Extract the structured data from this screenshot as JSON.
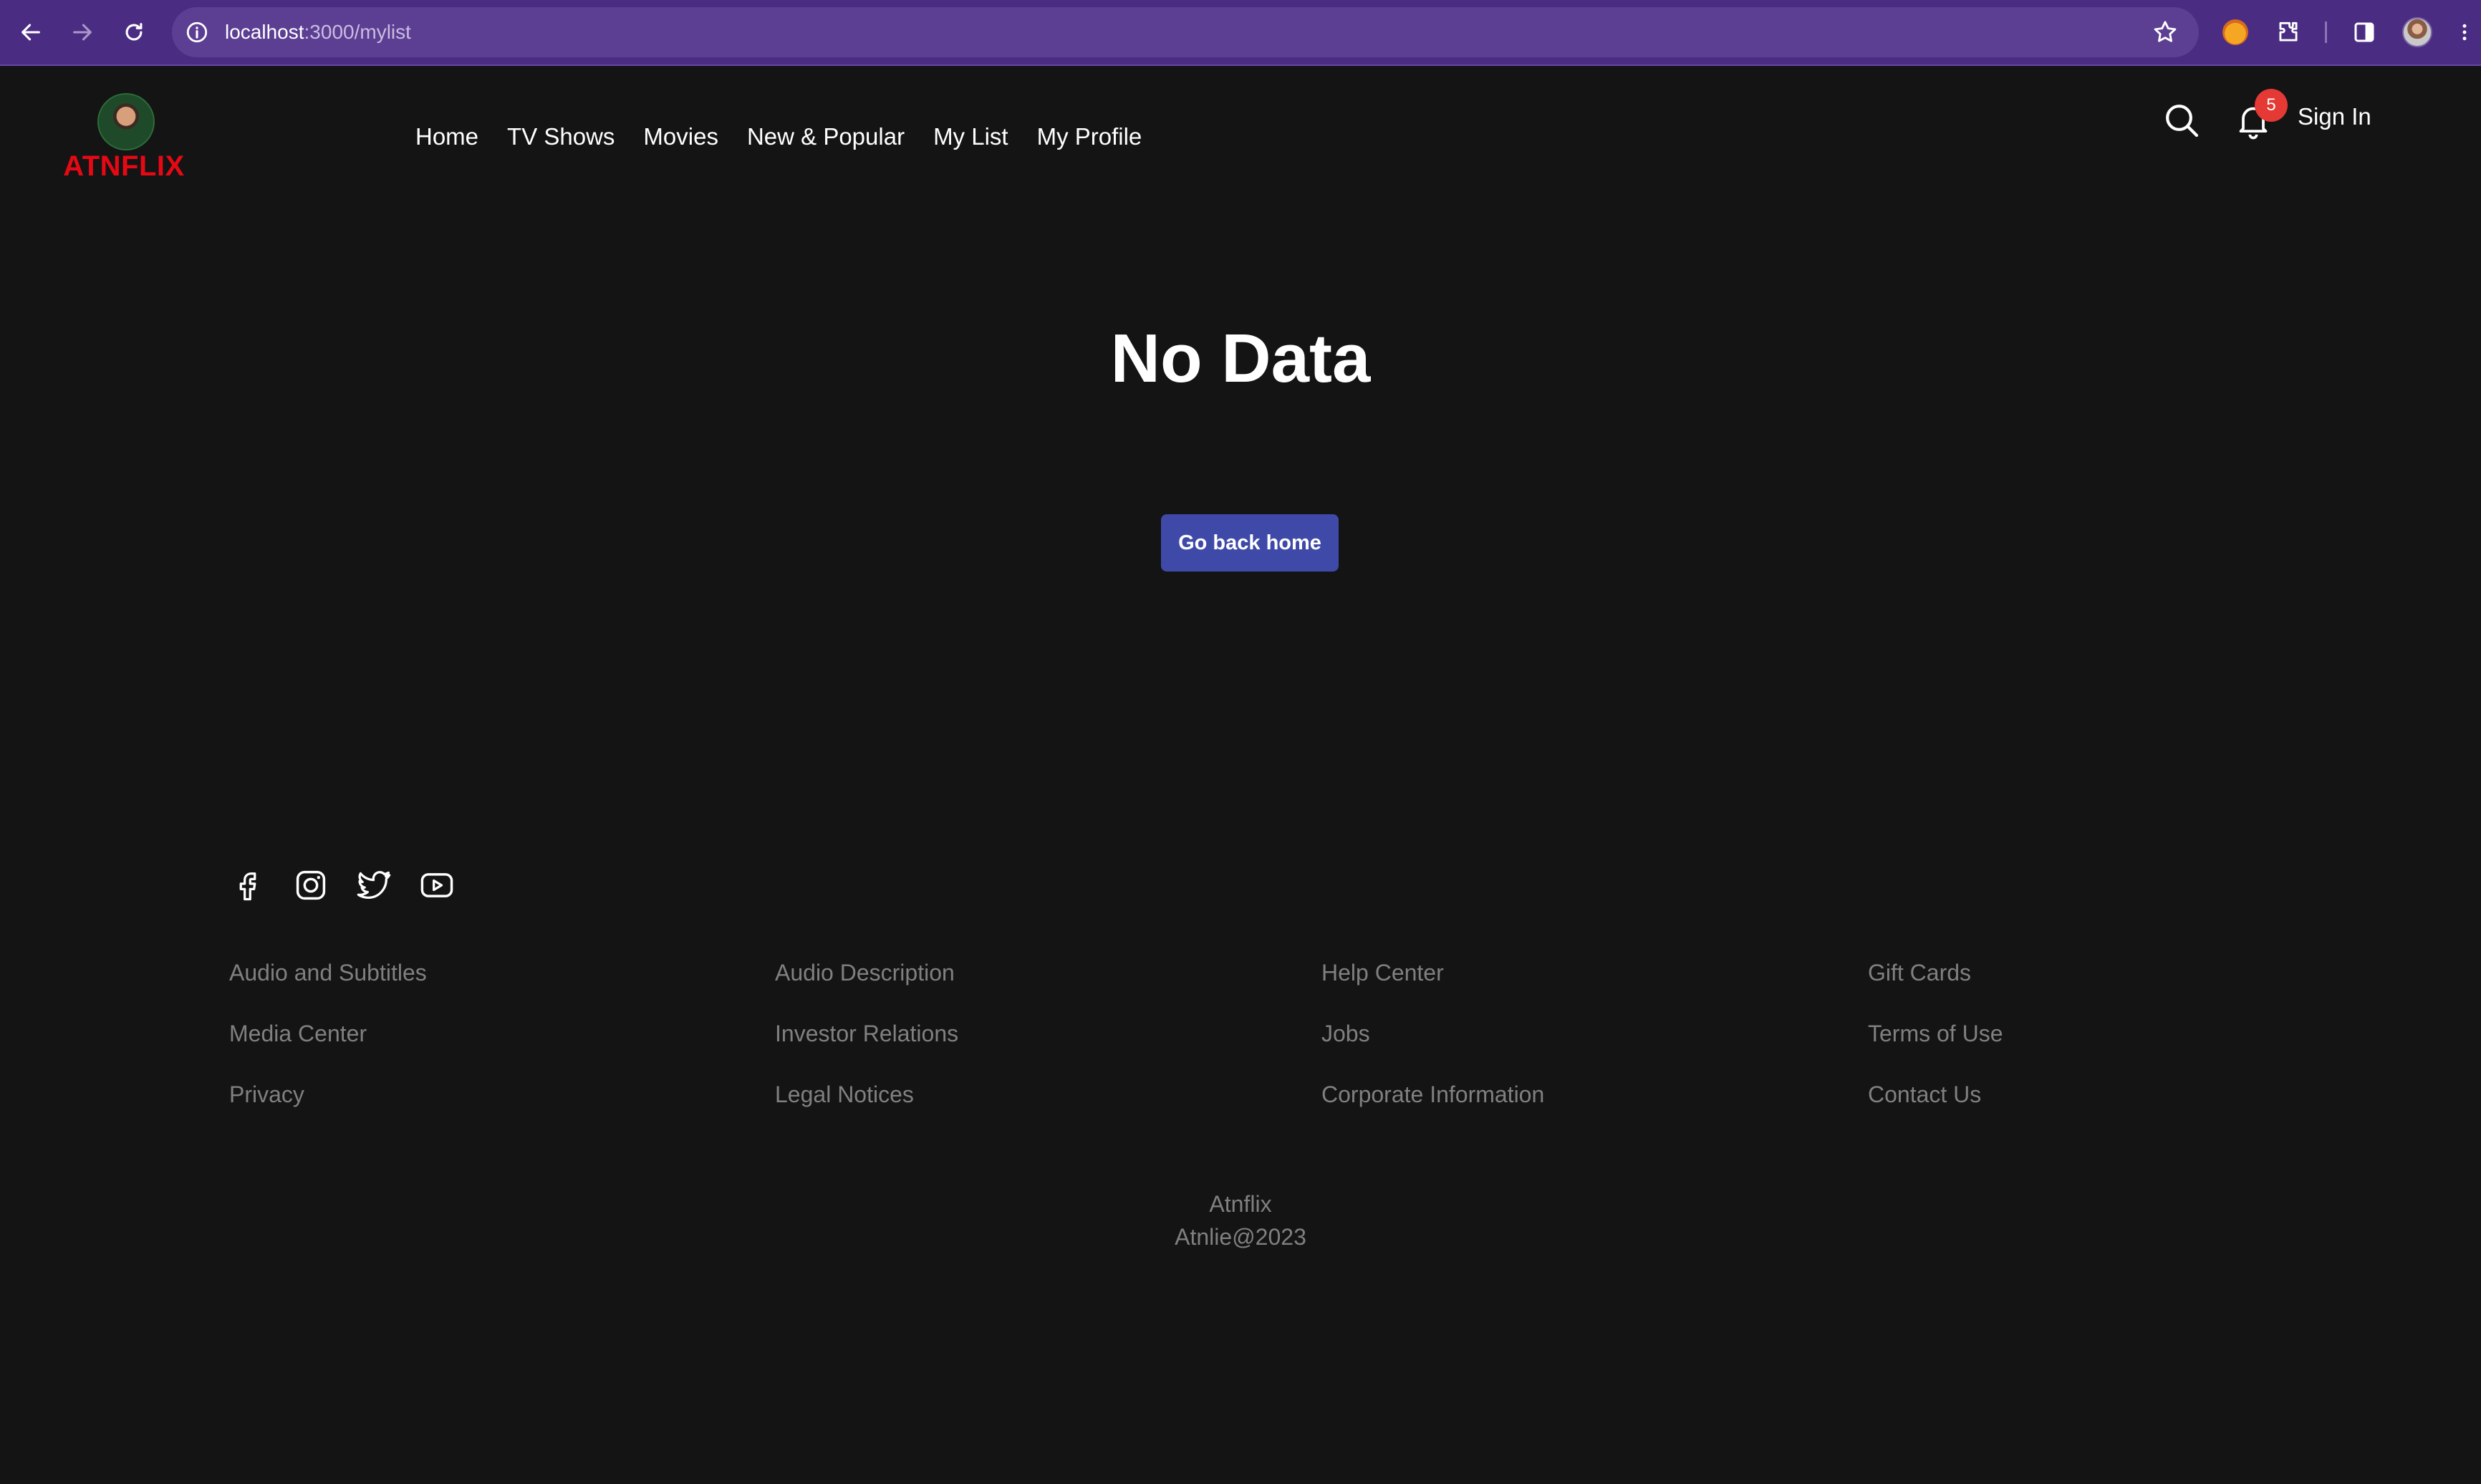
{
  "browser": {
    "url_host": "localhost",
    "url_path": ":3000/mylist"
  },
  "header": {
    "logo_text": "ATNFLIX",
    "nav": [
      {
        "label": "Home"
      },
      {
        "label": "TV Shows"
      },
      {
        "label": "Movies"
      },
      {
        "label": "New & Popular"
      },
      {
        "label": "My List"
      },
      {
        "label": "My Profile"
      }
    ],
    "notification_count": "5",
    "sign_in_label": "Sign In"
  },
  "main": {
    "title": "No Data",
    "button_label": "Go back home"
  },
  "footer": {
    "social": [
      "facebook-icon",
      "instagram-icon",
      "twitter-icon",
      "youtube-icon"
    ],
    "columns": [
      [
        "Audio and Subtitles",
        "Media Center",
        "Privacy"
      ],
      [
        "Audio Description",
        "Investor Relations",
        "Legal Notices"
      ],
      [
        "Help Center",
        "Jobs",
        "Corporate Information"
      ],
      [
        "Gift Cards",
        "Terms of Use",
        "Contact Us"
      ]
    ],
    "brand": "Atnflix",
    "copyright": "Atnlie@2023"
  },
  "colors": {
    "browser_bar": "#4a2c82",
    "background": "#141414",
    "logo": "#e50914",
    "button": "#3f4aa8",
    "badge": "#e53935",
    "footer_text": "#808080"
  }
}
